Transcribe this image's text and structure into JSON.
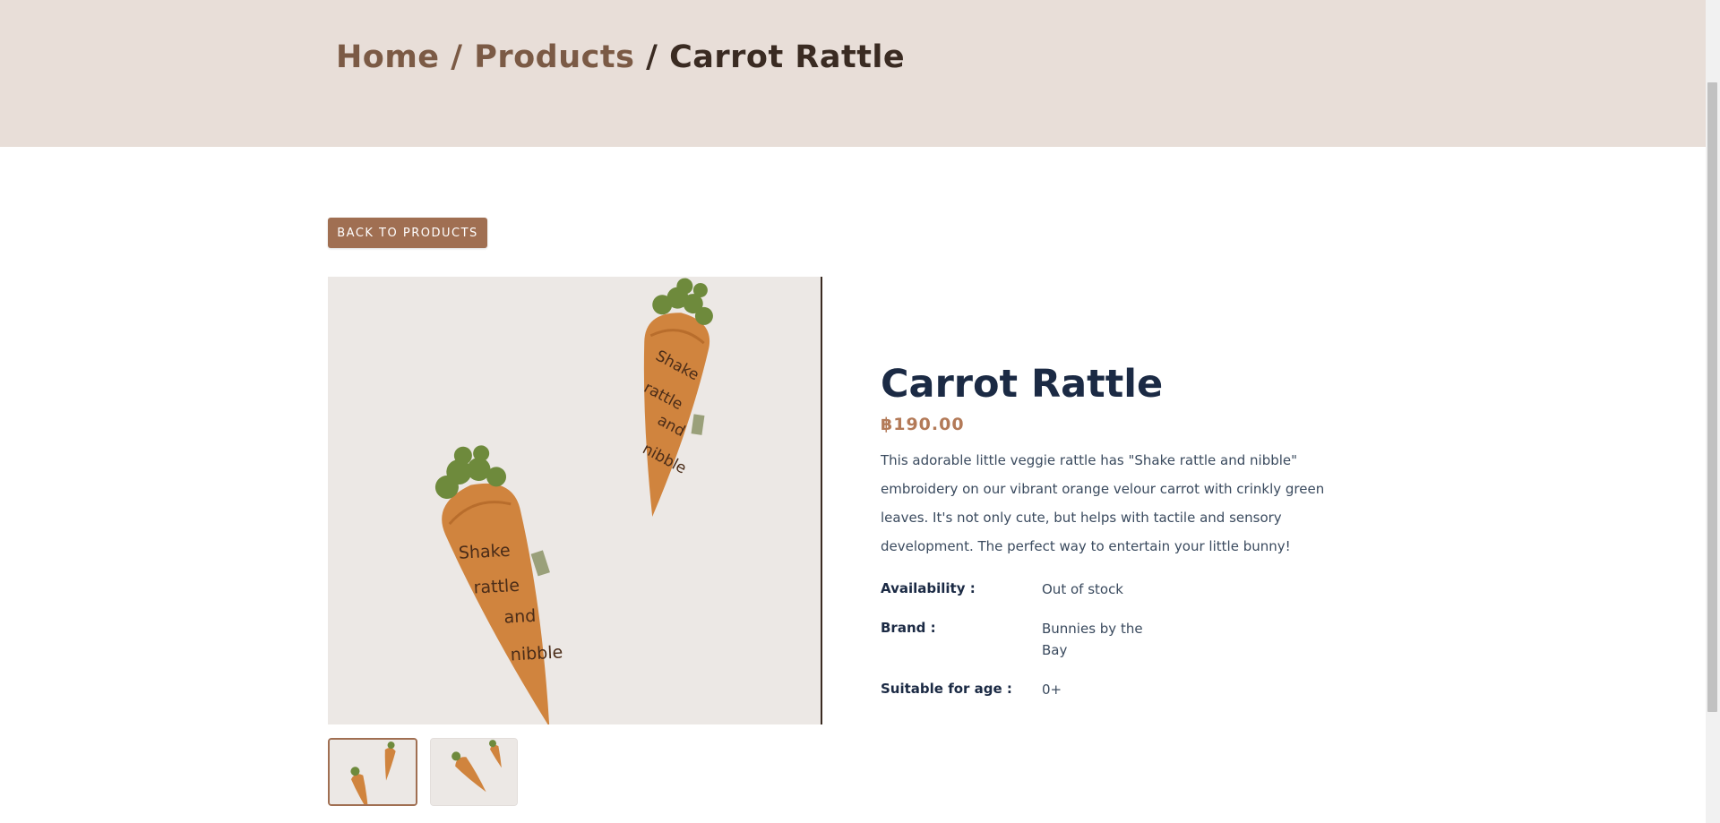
{
  "breadcrumb": {
    "home": "Home",
    "sep1": " / ",
    "products": "Products",
    "sep2": " / ",
    "current": "Carrot Rattle"
  },
  "back_button": "BACK TO PRODUCTS",
  "product": {
    "title": "Carrot Rattle",
    "price": "฿190.00",
    "description": "This adorable little veggie rattle has \"Shake rattle and nibble\" embroidery on our vibrant orange velour carrot with crinkly green leaves. It's not only cute, but helps with tactile and sensory development. The perfect way to entertain your little bunny!",
    "specs": [
      {
        "label": "Availability :",
        "value": "Out of stock"
      },
      {
        "label": "Brand :",
        "value": "Bunnies by the Bay"
      },
      {
        "label": "Suitable for age :",
        "value": "0+"
      }
    ],
    "embroidery_words": [
      "Shake",
      "rattle",
      "and",
      "nibble"
    ]
  },
  "gallery": {
    "thumbnails": [
      {
        "name": "thumbnail-1",
        "active": true
      },
      {
        "name": "thumbnail-2",
        "active": false
      }
    ]
  },
  "colors": {
    "hero_bg": "#e8ded8",
    "accent": "#a06f52",
    "price": "#b37a58",
    "title": "#1b2a44",
    "carrot": "#d0843e",
    "leaves": "#6e8a3c"
  }
}
